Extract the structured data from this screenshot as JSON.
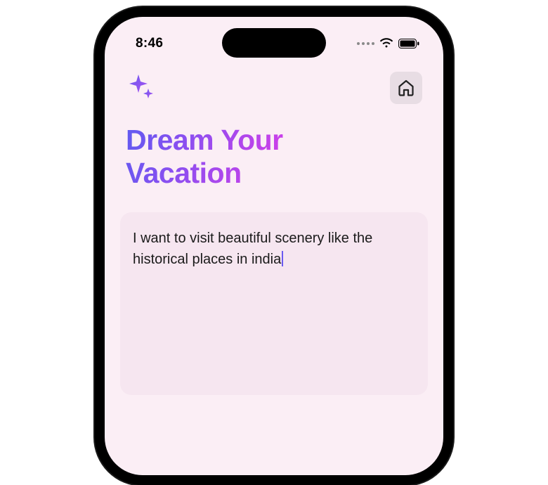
{
  "status_bar": {
    "time": "8:46"
  },
  "header": {
    "sparkle_icon_name": "sparkle-icon",
    "home_icon_name": "home-icon"
  },
  "main": {
    "title_line1": "Dream Your",
    "title_line2": "Vacation",
    "input_value": "I want to visit beautiful scenery like the historical places in india"
  }
}
